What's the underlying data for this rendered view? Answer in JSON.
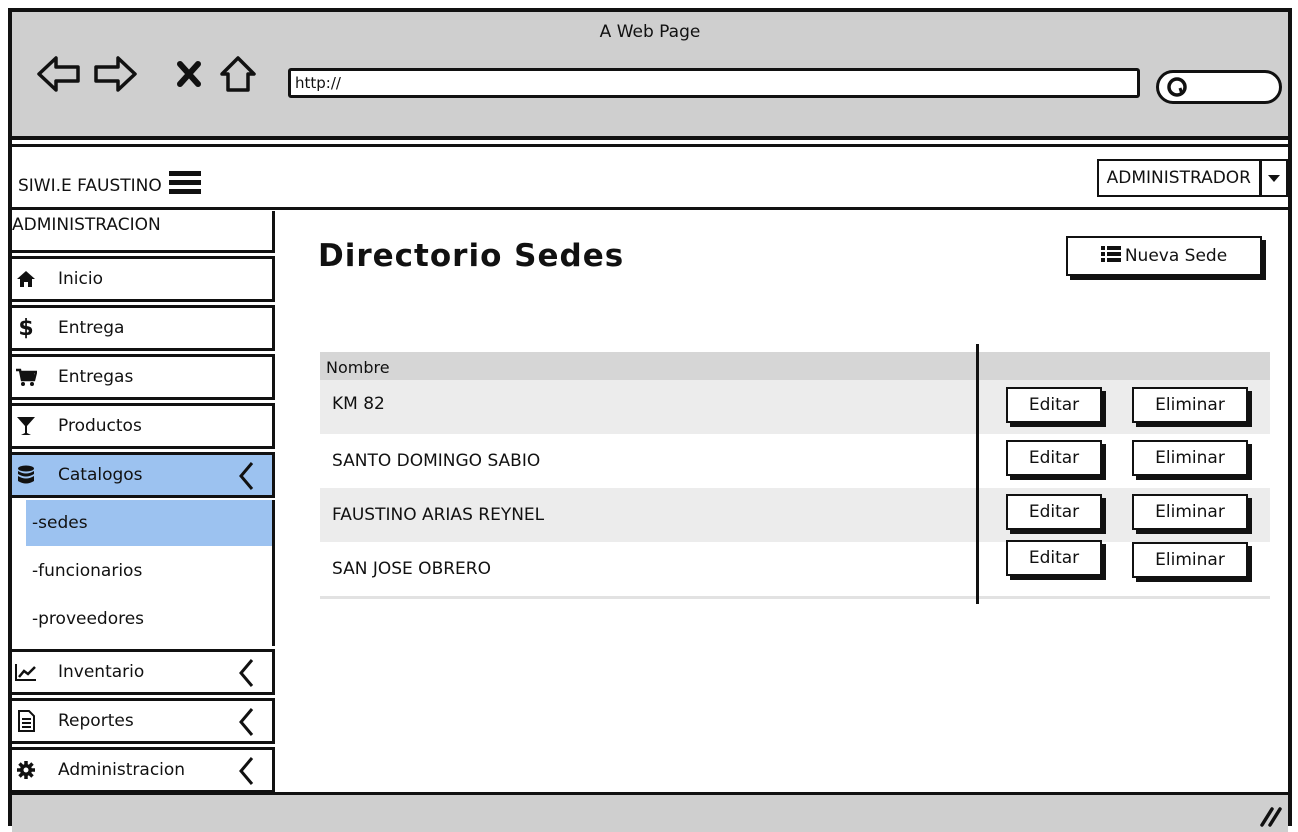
{
  "browser": {
    "title": "A Web Page",
    "url": "http://"
  },
  "header": {
    "brand": "SIWI.E FAUSTINO",
    "user_menu": "ADMINISTRADOR"
  },
  "sidebar": {
    "section_title": "ADMINISTRACION",
    "items": [
      {
        "label": "Inicio",
        "icon": "home-icon"
      },
      {
        "label": "Entrega",
        "icon": "dollar-icon"
      },
      {
        "label": "Entregas",
        "icon": "cart-icon"
      },
      {
        "label": "Productos",
        "icon": "cocktail-icon"
      },
      {
        "label": "Catalogos",
        "icon": "database-icon",
        "active": true
      },
      {
        "label": "Inventario",
        "icon": "chart-icon"
      },
      {
        "label": "Reportes",
        "icon": "document-icon"
      },
      {
        "label": "Administracion",
        "icon": "gear-icon"
      }
    ],
    "submenu": [
      {
        "label": "-sedes",
        "selected": true
      },
      {
        "label": "-funcionarios"
      },
      {
        "label": "-proveedores"
      }
    ]
  },
  "main": {
    "title": "Directorio Sedes",
    "new_button": "Nueva Sede",
    "table": {
      "column": "Nombre",
      "rows": [
        {
          "name": "KM 82"
        },
        {
          "name": "SANTO DOMINGO SABIO"
        },
        {
          "name": "FAUSTINO ARIAS REYNEL"
        },
        {
          "name": "SAN JOSE OBRERO"
        }
      ],
      "edit_label": "Editar",
      "delete_label": "Eliminar"
    }
  },
  "colors": {
    "chrome": "#cfcfcf",
    "active": "#9cc2f0",
    "table_header": "#d6d6d6",
    "row_alt": "#ececec"
  }
}
